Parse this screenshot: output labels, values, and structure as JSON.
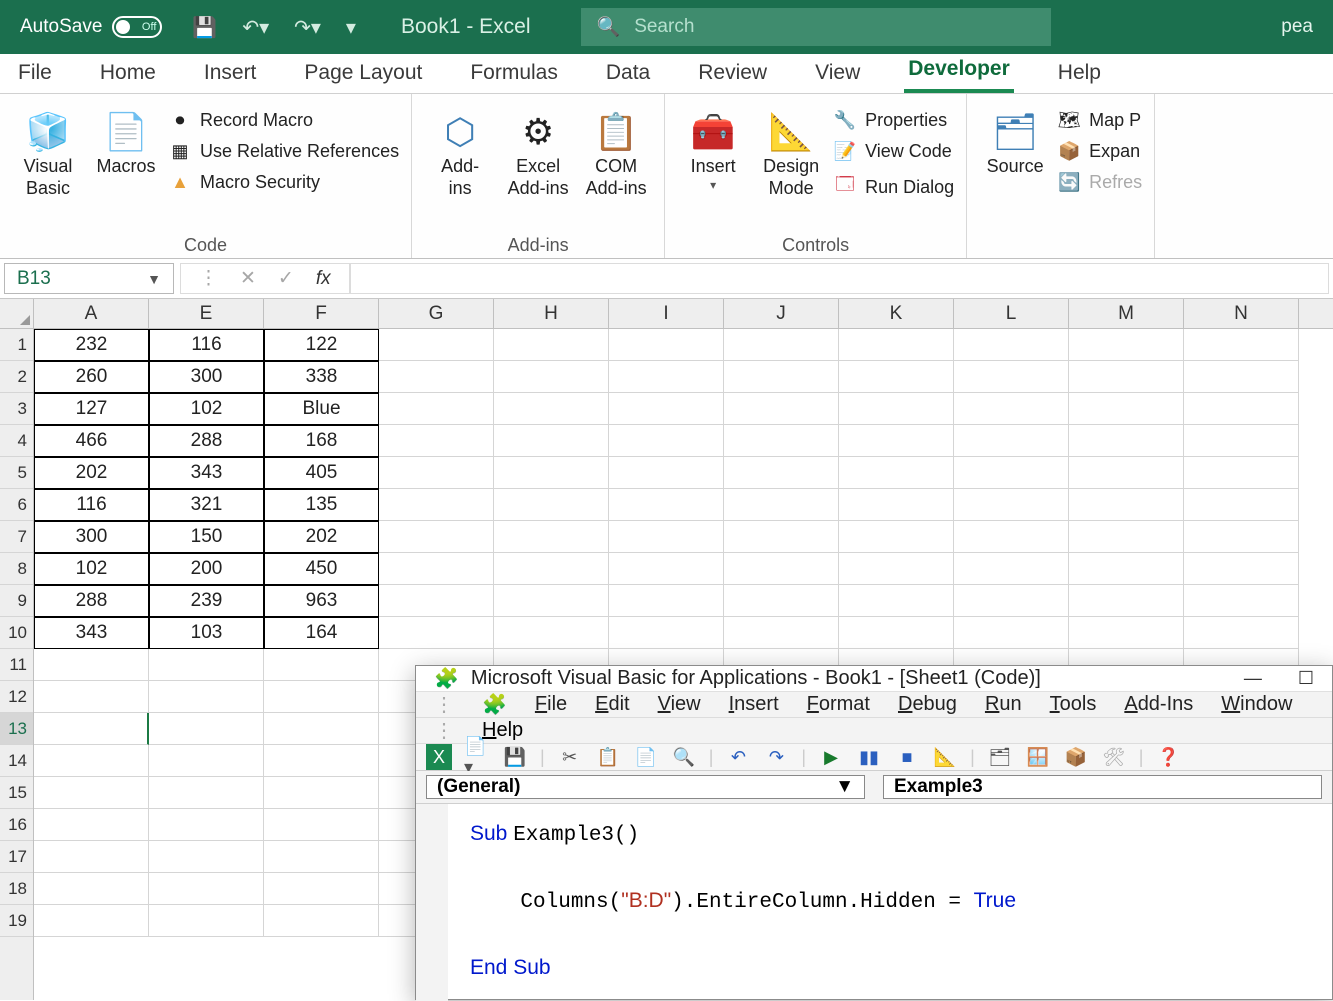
{
  "titlebar": {
    "autosave_label": "AutoSave",
    "autosave_state": "Off",
    "document_title": "Book1 - Excel",
    "search_placeholder": "Search",
    "user_hint": "pea"
  },
  "tabs": [
    "File",
    "Home",
    "Insert",
    "Page Layout",
    "Formulas",
    "Data",
    "Review",
    "View",
    "Developer",
    "Help"
  ],
  "active_tab": "Developer",
  "ribbon": {
    "visual_basic": "Visual\nBasic",
    "macros": "Macros",
    "record_macro": "Record Macro",
    "use_relative": "Use Relative References",
    "macro_security": "Macro Security",
    "code_group": "Code",
    "addins": "Add-\nins",
    "excel_addins": "Excel\nAdd-ins",
    "com_addins": "COM\nAdd-ins",
    "addins_group": "Add-ins",
    "insert": "Insert",
    "design_mode": "Design\nMode",
    "properties": "Properties",
    "view_code": "View Code",
    "run_dialog": "Run Dialog",
    "controls_group": "Controls",
    "source": "Source",
    "map_props": "Map P",
    "expansion": "Expan",
    "refresh": "Refres"
  },
  "namebox_value": "B13",
  "grid": {
    "columns": [
      "A",
      "E",
      "F",
      "G",
      "H",
      "I",
      "J",
      "K",
      "L",
      "M",
      "N"
    ],
    "row_labels": [
      "1",
      "2",
      "3",
      "4",
      "5",
      "6",
      "7",
      "8",
      "9",
      "10",
      "11",
      "12",
      "13",
      "14",
      "15",
      "16",
      "17",
      "18",
      "19"
    ],
    "data": [
      [
        "232",
        "116",
        "122"
      ],
      [
        "260",
        "300",
        "338"
      ],
      [
        "127",
        "102",
        "Blue"
      ],
      [
        "466",
        "288",
        "168"
      ],
      [
        "202",
        "343",
        "405"
      ],
      [
        "116",
        "321",
        "135"
      ],
      [
        "300",
        "150",
        "202"
      ],
      [
        "102",
        "200",
        "450"
      ],
      [
        "288",
        "239",
        "963"
      ],
      [
        "343",
        "103",
        "164"
      ]
    ],
    "active_row": 13
  },
  "vba": {
    "title": "Microsoft Visual Basic for Applications - Book1 - [Sheet1 (Code)]",
    "menus": [
      "File",
      "Edit",
      "View",
      "Insert",
      "Format",
      "Debug",
      "Run",
      "Tools",
      "Add-Ins",
      "Window"
    ],
    "menus2": [
      "Help"
    ],
    "object_dd": "(General)",
    "proc_dd": "Example3",
    "code_lines": [
      {
        "parts": [
          {
            "t": "Sub ",
            "c": "kw"
          },
          {
            "t": "Example3()"
          }
        ]
      },
      {
        "parts": []
      },
      {
        "parts": [
          {
            "t": "    Columns("
          },
          {
            "t": "\"B:D\"",
            "c": "str"
          },
          {
            "t": ").EntireColumn.Hidden = "
          },
          {
            "t": "True",
            "c": "val"
          }
        ]
      },
      {
        "parts": []
      },
      {
        "parts": [
          {
            "t": "End Sub",
            "c": "kw"
          }
        ]
      }
    ]
  }
}
